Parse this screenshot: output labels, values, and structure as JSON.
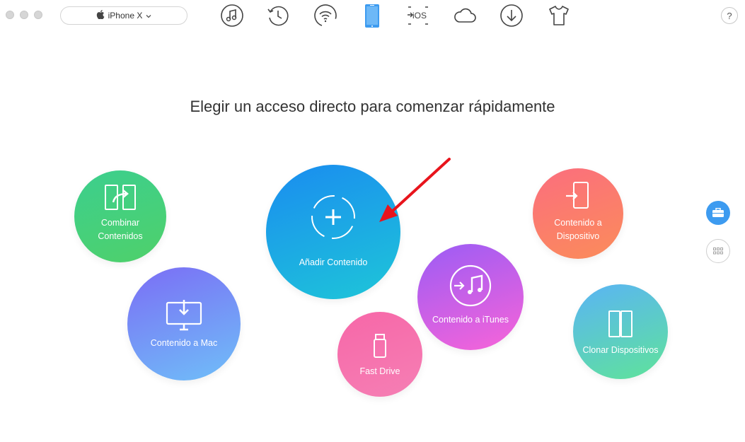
{
  "window": {
    "traffic_lights": [
      "close",
      "minimize",
      "zoom"
    ]
  },
  "toolbar": {
    "device_name": "iPhone X",
    "device_icon": "apple-logo-icon",
    "tools": [
      {
        "name": "music-icon",
        "active": false
      },
      {
        "name": "history-icon",
        "active": false
      },
      {
        "name": "wifi-icon",
        "active": false
      },
      {
        "name": "phone-icon",
        "active": true
      },
      {
        "name": "to-ios-icon",
        "active": false,
        "text": "iOS"
      },
      {
        "name": "cloud-icon",
        "active": false
      },
      {
        "name": "download-icon",
        "active": false
      },
      {
        "name": "shirt-icon",
        "active": false
      }
    ],
    "help_label": "?",
    "accent_color": "#3d9bf0"
  },
  "main": {
    "title": "Elegir un acceso directo para comenzar rápidamente",
    "shortcuts": [
      {
        "id": "combinar",
        "label": "Combinar\nContenidos",
        "gradient": [
          "#3ccf8e",
          "#4fd06a"
        ]
      },
      {
        "id": "mac",
        "label": "Contenido a Mac",
        "gradient": [
          "#7b6df5",
          "#6fbff8"
        ]
      },
      {
        "id": "anadir",
        "label": "Añadir Contenido",
        "gradient": [
          "#1a8cf0",
          "#1ec6d8"
        ]
      },
      {
        "id": "fastdrive",
        "label": "Fast Drive",
        "gradient": [
          "#f767a8",
          "#f57fb4"
        ]
      },
      {
        "id": "itunes",
        "label": "Contenido a iTunes",
        "gradient": [
          "#9b5cf5",
          "#f864d8"
        ]
      },
      {
        "id": "dispositivo",
        "label": "Contenido a\nDispositivo",
        "gradient": [
          "#fb6e7e",
          "#fb8c5a"
        ]
      },
      {
        "id": "clonar",
        "label": "Clonar Dispositivos",
        "gradient": [
          "#5ab4f5",
          "#5fe39a"
        ]
      }
    ]
  },
  "side": {
    "buttons": [
      {
        "name": "toolbox-icon",
        "active": true
      },
      {
        "name": "grid-icon",
        "active": false
      }
    ]
  },
  "annotation": {
    "arrow_color": "#e8141c"
  }
}
